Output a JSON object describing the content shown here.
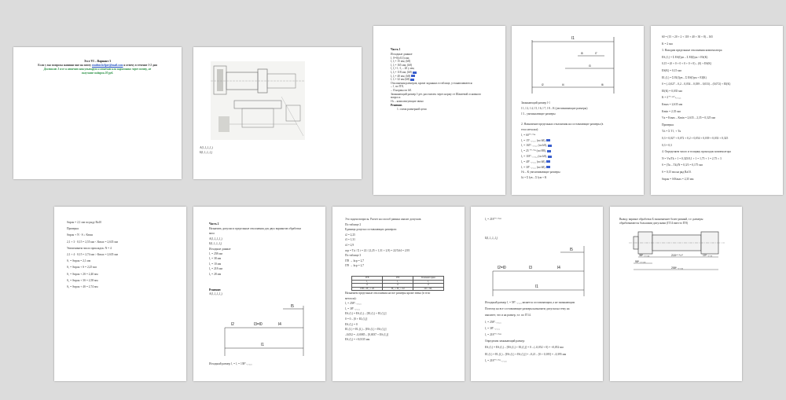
{
  "page1": {
    "title": "Эссе VI – Вариант 3",
    "line_contact_pre": "Если у вас вопросы напиши мне на почту",
    "email": "student.helper@mail.com",
    "line_contact_post": "я отвечу в течение 1-2 дня",
    "promo_1": "Доставлю 3 эссе и отвечаю консультирую и отвечаю или нарисовано через почту, не",
    "promo_2": "получите подарок 20 руб."
  },
  "page2": {
    "cap1": "A(l₁,l₂,l₃,l₄)",
    "cap2": "Б(l₁,l₂,l₃,l₄)"
  },
  "page3": {
    "heading": "Часть 1",
    "lines": [
      "Исходные данные",
      "l₁ 0=0(±0,3) мм;",
      "l₂ l₂= 15 мм; (h8)",
      "l₃ l₃= 165 мм; (h8)",
      "l₄ l₄= l₁-l₂ – 20 у мм;",
      "l₅ l₅= 118 мм; (h8)",
      "l₆ l₆= 40 мм; (h8)",
      "l₇ l₇= 32 мм (h8)",
      "Отклонения размеров, кроме заданных в таблице, устанавливаются:",
      "– l₁ по IT8,",
      "– l3 нормы по h8.",
      "Замыкающий размер l-дет. рассчитать через норму от Шакеевой основного",
      "вопроса",
      "l-k – комплектующие звено"
    ],
    "solution": "Решение.",
    "step1": "1.   схема размерной цепи"
  },
  "page4": {
    "lines": [
      "Замыкающий размер l-1",
      "l 1, l 2, l 4, l 5, l 6, l 7, l 8 – К (увеличивающие размеры)",
      "l 3 – уменьшающие размеры",
      "",
      "2.  Назначение предельных отклонения на составляющие размеры (в",
      "тело металла):",
      "l₁ = 60⁺⁰·⁰⁹⁴",
      "l₂ = 15⁰₋₀.₀₂₇      (по h8),",
      "l₃ = 165⁰₋₀.₀₆₃      (по h8),",
      "l₄ = 25 ⁺⁰·⁰³³       (по H8),",
      "l₅ = 118⁰₋₀.₀₅₄       (по h8),",
      "l₆ = 40⁰₋₀.₀₃₉        (по h8),",
      "l₇ = 30⁰₋₀.₀₃₃        (по h8),",
      "l-k – K увеличивающие размеры",
      "l∆ = Σ lув – Σ lум + K"
    ],
    "labels": [
      "l1",
      "l5",
      "l7",
      "l3",
      "l2",
      "l4",
      "l6"
    ]
  },
  "page5": {
    "lines": [
      "60 = (15 + 20 + 2 + 118 + 40 + 30 + 8) – 165",
      "K = 2 мм",
      "3.  Находим предельные отклонения компенсатора",
      "ES₁(l₁) = Σ ES(l)ув – Σ EI(l)ум + ES(K)",
      "0,15 = (0 + 0 + 0 + 0 + 0 + 0) – (0) + ES(K)",
      "ES(K) = 0,15 мм",
      "EI₁(l₁) = Σ EI(l)ув – Σ ES(l)ум + EI(K)",
      "0 = (–0,027 – 0,2 – 0,054 – 0,039 – 0,033) – (0,072) + EI(K)",
      "EI(K) = 0,035 мм",
      "K = 2⁺⁰·¹⁵⁰₊₀.₀₃₅",
      "Kmax = 2,635 мм",
      "Kmin = 2,35 мм",
      "Vк = Kmax – Kmin = 2,635 – 2,35 = 0,325 мм",
      "Проверка:",
      "T∆ = Σ T l₁ + Tк",
      "0,3 = 0,027 + 0,072 + 0,2 + 0,054 + 0,039 + 0,033 + 0,325",
      "0,3 = 0,3",
      "4.  Определяем число и толщину прокладок компенсатора",
      "N = Vк/Tk + 1 = 0,325/0,1 + 1 = 1,75 + 1 = 2,75 ≈ 3",
      "S = (Tк – Tk)/N = 0,3/3 = 0,175 мм",
      "S = 0,15 мм на ряд Ra10.",
      "Sпрок = S/Kmax = 2,35 мм"
    ]
  },
  "page6": {
    "lines": [
      "Sпрок = 2,1 мм по ряду Ra10",
      "Проверка:",
      "Sпрок + N · S ≥ Kmax",
      "2,1 + 3 · 0,15 = 2,55 мм < Kmax = 2,635 мм",
      "Увеличиваем число прокладок: N = 4",
      "2,1 + 4 · 0,15 = 2,74 мм > Kmax = 2,635 мм",
      "S₁ = Sпрок = 2,1 мм",
      "S₂ = Sпрок + S = 2,25 мм",
      "S₃ = Sпрок + 2S = 2,40 мм",
      "S₄ = Sпрок + 3S = 2,58 мм",
      "S₅ = Sпрок + 4S = 2,74 мм"
    ]
  },
  "page7": {
    "heading": "Часть 2",
    "lines": [
      "Назначить допуски и предельные отклонения для двух вариантов обработки",
      "вала",
      "A(l₁,l₂,l₃,l₄)",
      "Б(l₁,l₂,l₃,l₄)",
      "Исходные данные",
      "l₁ = 258 мм",
      "l₂ = 38 мм",
      "l₃ = 10 мм",
      "l₄ = 218 мм",
      "l₅ = 28 мм"
    ],
    "solution": "Решение:",
    "variant": "A(l₁,l₂,l₃,l₄)",
    "labels": [
      "l5",
      "l2",
      "l3=l0",
      "l4",
      "l1"
    ],
    "footer": "Исходный размер l₁ = l₁ = 138⁰₋₀.₀₂₈"
  },
  "page8": {
    "lines": [
      "Это задача вопросы. Расчет на способ равных квалит допусков.",
      "По таблице 2",
      "Единица допуска составляющих размеров:",
      "i2 = 2,25",
      "i3 = 1,31",
      "i4 = 2,9",
      "aср = T∆ / Σ i = 22 / (2,25 + 1,31 + 2,9) = 22/5,64 = 2,95",
      "По таблице 3",
      "IT8  → kср = 2,7",
      "IT9  → kср = 2,7"
    ],
    "table": [
      [
        "IT8",
        "IT9",
        "Комментарии"
      ],
      [
        "l₂",
        "l₃",
        "l₄"
      ],
      [
        "0",
        "0",
        "0"
      ],
      [
        "IT8 = IT₈ = 22",
        "IT₉ = IT₉ = 22",
        "l2l = l2l₁"
      ]
    ],
    "lines2": [
      "Назначаем предельные отклонения на все размеры кроме звена (в тело",
      "металла):",
      "l₂ = 258⁰₋₀.₀₂₂",
      "l₃ = 38⁰₋₀.₀₁₆",
      "ES₁(l₁) = ES₁(l₂) – [EI₁(l₃) + EI₁(l₄)]",
      "0 = 0 – [0 + EI₁(l₄)]",
      "ES₁(l₄) = 0",
      "EI₁(l₁) = EI₁(l₂) – [ES₁(l₃) + ES₁(l₄)]",
      "–0,052 = –0,0085 – [0,0037 + ES₁(l₄)]",
      "ES₁(l₄) = +0,0135 мм"
    ]
  },
  "page9": {
    "top": "l₄ = 218⁺⁰·⁰¹³⁵",
    "caption": "Б(l₁,l₂,l₃,l₄)",
    "labels": [
      "l5",
      "l2=l0",
      "l3",
      "l4",
      "l1"
    ],
    "lines": [
      "Исходный размер l₁ = 58⁰₋₀.₀₂₈ является составляющим, а не замыкающим",
      "Поэтому на все составляющие размеры назначаем допуски на тему на",
      "квалитет, что и на размер, т.е. по IT14.",
      "l₁ = 258⁰₋₀.₀₂₂",
      "l₂ = 38⁰₋₀.₀₁₆",
      "l₃ = 218⁺⁰·⁰¹³⁵",
      "Определим замыкающий размер:",
      "ES₁(l₁) = ES₁(l₂) – [ES₁(l₃) + EI₁(l₄)] = 0 – (–0,052 + 0) = +0,052 мм",
      "EI₁(l₁) = EI₁(l₂) – [ES₁(l₃) + ES₁(l₄)] = –0,21 – [0 + 0,185] = –0,395 мм",
      "l₀ = 218⁺⁰·⁰⁵²₋₀.₃₉₅"
    ]
  },
  "page10": {
    "lines": [
      "Вывод: вариант обработки Б экономичнее более ровный, т.е. размеры",
      "обрабатываются большими допусками (IT14 вместо IT8)"
    ],
    "dims": [
      "38⁰₋₀.₀₁₆",
      "218⁺⁰·⁰¹³⁵",
      "10⁰₋₀.₀₉",
      "58⁰₋₀.₀₂₈",
      "258⁰₋₀.₀₂₂"
    ]
  }
}
